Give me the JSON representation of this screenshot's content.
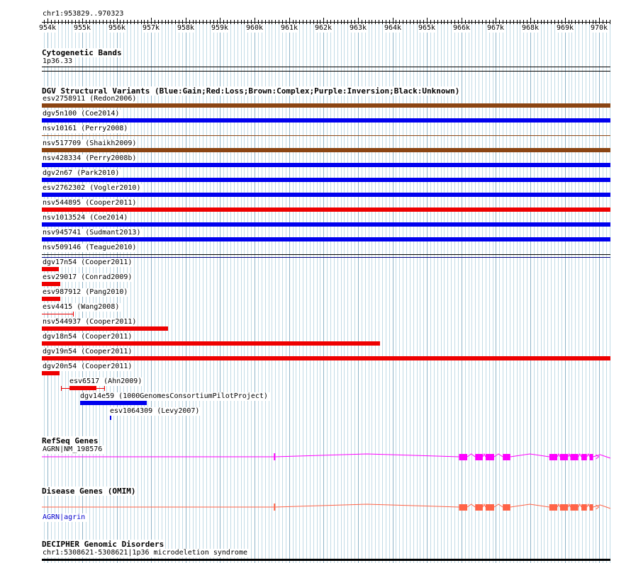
{
  "ruler": {
    "location": "chr1:953829..970323",
    "start": 953829,
    "end": 970323,
    "tick_labels": [
      "954k",
      "955k",
      "956k",
      "957k",
      "958k",
      "959k",
      "960k",
      "961k",
      "962k",
      "963k",
      "964k",
      "965k",
      "966k",
      "967k",
      "968k",
      "969k",
      "970k"
    ]
  },
  "cytobands": {
    "title": "Cytogenetic Bands",
    "band": "1p36.33"
  },
  "dgv": {
    "title": "DGV Structural Variants (Blue:Gain;Red:Loss;Brown:Complex;Purple:Inversion;Black:Unknown)",
    "colors": {
      "gain": "#0000ee",
      "loss": "#ee0000",
      "complex": "#8b4513",
      "unknown": "#000000"
    },
    "variants": [
      {
        "label": "esv2758911 (Redon2006)",
        "type": "complex",
        "start": 953829,
        "end": 970323,
        "thick": true
      },
      {
        "label": "dgv5n100 (Coe2014)",
        "type": "gain",
        "start": 953829,
        "end": 970323,
        "thick": true
      },
      {
        "label": "nsv10161 (Perry2008)",
        "type": "complex",
        "start": 953829,
        "end": 970323,
        "thick": false
      },
      {
        "label": "nsv517709 (Shaikh2009)",
        "type": "complex",
        "start": 953829,
        "end": 970323,
        "thick": true
      },
      {
        "label": "nsv428334 (Perry2008b)",
        "type": "gain",
        "start": 953829,
        "end": 970323,
        "thick": true
      },
      {
        "label": "dgv2n67 (Park2010)",
        "type": "gain",
        "start": 953829,
        "end": 970323,
        "thick": true
      },
      {
        "label": "esv2762302 (Vogler2010)",
        "type": "gain",
        "start": 953829,
        "end": 970323,
        "thick": true
      },
      {
        "label": "nsv544895 (Cooper2011)",
        "type": "loss",
        "start": 953829,
        "end": 970323,
        "thick": true
      },
      {
        "label": "nsv1013524 (Coe2014)",
        "type": "gain",
        "start": 953829,
        "end": 970323,
        "thick": true
      },
      {
        "label": "nsv945741 (Sudmant2013)",
        "type": "gain",
        "start": 953829,
        "end": 970323,
        "thick": true
      },
      {
        "label": "nsv509146 (Teague2010)",
        "type": "unknown",
        "start": 953829,
        "end": 970323,
        "thick": false
      },
      {
        "label": "dgv17n54 (Cooper2011)",
        "type": "loss",
        "start": 953829,
        "end": 954330,
        "thick": true
      },
      {
        "label": "esv29017 (Conrad2009)",
        "type": "loss",
        "start": 953829,
        "end": 954360,
        "thick": true
      },
      {
        "label": "esv987912 (Pang2010)",
        "type": "loss",
        "start": 953829,
        "end": 954360,
        "thick": true
      },
      {
        "label": "esv4415 (Wang2008)",
        "type": "loss",
        "start": 953829,
        "end": 954760,
        "thick": false
      },
      {
        "label": "nsv544937 (Cooper2011)",
        "type": "loss",
        "start": 953829,
        "end": 957480,
        "thick": true
      },
      {
        "label": "dgv18n54 (Cooper2011)",
        "type": "loss",
        "start": 953829,
        "end": 963640,
        "thick": true
      },
      {
        "label": "dgv19n54 (Cooper2011)",
        "type": "loss",
        "start": 953829,
        "end": 970323,
        "thick": true
      },
      {
        "label": "dgv20n54 (Cooper2011)",
        "type": "loss",
        "start": 953829,
        "end": 954340,
        "thick": true
      },
      {
        "label": "esv6517 (Ahn2009)",
        "type": "loss",
        "start": 954640,
        "end": 955420,
        "thick": true,
        "whiskers": true
      },
      {
        "label": "dgv14e59 (1000GenomesConsortiumPilotProject)",
        "type": "gain",
        "start": 954930,
        "end": 956880,
        "thick": true
      },
      {
        "label": "esv1064309 (Levy2007)",
        "type": "gain",
        "start": 955800,
        "end": 955840,
        "thick": true
      }
    ]
  },
  "refseq": {
    "title": "RefSeq Genes",
    "gene_label": "AGRN|NM_198576",
    "color": "#ff00ff"
  },
  "omim": {
    "title": "Disease Genes (OMIM)",
    "gene_label": "AGRN|agrin",
    "color": "#ff6347"
  },
  "decipher": {
    "title": "DECIPHER Genomic Disorders",
    "label": "chr1:5308621-5308621|1p36 microdeletion syndrome"
  },
  "gene_model": {
    "strand": "+",
    "start": 953829,
    "end": 970323,
    "exons": [
      [
        960559,
        960600
      ],
      [
        965930,
        966170
      ],
      [
        966400,
        966620
      ],
      [
        966700,
        966950
      ],
      [
        967200,
        967420
      ],
      [
        968550,
        968780
      ],
      [
        968860,
        969090
      ],
      [
        969160,
        969390
      ],
      [
        969480,
        969640
      ],
      [
        969720,
        969820
      ]
    ]
  }
}
